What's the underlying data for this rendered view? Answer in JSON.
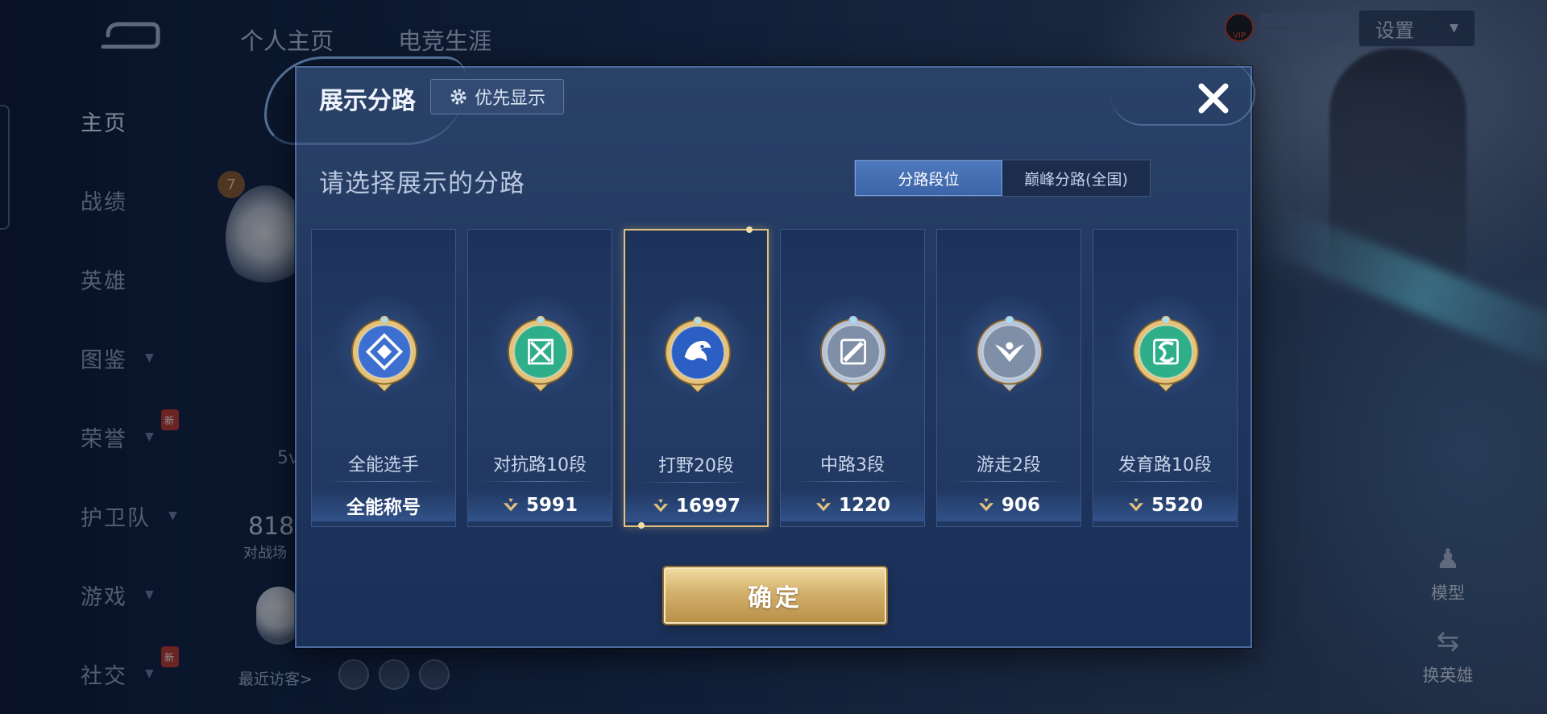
{
  "sidebar": {
    "items": [
      {
        "label": "主页",
        "active": true,
        "has_chevron": false,
        "badge": ""
      },
      {
        "label": "战绩",
        "active": false,
        "has_chevron": false,
        "badge": ""
      },
      {
        "label": "英雄",
        "active": false,
        "has_chevron": false,
        "badge": ""
      },
      {
        "label": "图鉴",
        "active": false,
        "has_chevron": true,
        "badge": ""
      },
      {
        "label": "荣誉",
        "active": false,
        "has_chevron": true,
        "badge": "新"
      },
      {
        "label": "护卫队",
        "active": false,
        "has_chevron": true,
        "badge": ""
      },
      {
        "label": "游戏",
        "active": false,
        "has_chevron": true,
        "badge": ""
      },
      {
        "label": "社交",
        "active": false,
        "has_chevron": true,
        "badge": "新"
      }
    ]
  },
  "header": {
    "tabs": [
      "个人主页",
      "电竞生涯"
    ],
    "settings_label": "设置",
    "vip_label": "VIP"
  },
  "profile_bg": {
    "level": "7",
    "games_count": "818",
    "games_label": "对战场",
    "recent_visitors_label": "最近访客>",
    "mode_text": "5v"
  },
  "right_actions": [
    {
      "label": "模型",
      "icon": "figure-icon"
    },
    {
      "label": "换英雄",
      "icon": "hero-swap-icon"
    }
  ],
  "modal": {
    "title": "展示分路",
    "priority_label": "优先显示",
    "subtitle": "请选择展示的分路",
    "tabs": [
      {
        "label": "分路段位",
        "active": true
      },
      {
        "label": "巅峰分路(全国)",
        "active": false
      }
    ],
    "lanes": [
      {
        "name": "全能选手",
        "value": "全能称号",
        "has_points_icon": false,
        "selected": false,
        "emblem": "all-round-emblem-icon",
        "color": "#3c6fd0"
      },
      {
        "name": "对抗路10段",
        "value": "5991",
        "has_points_icon": true,
        "selected": false,
        "emblem": "clash-lane-emblem-icon",
        "color": "#2fae8a"
      },
      {
        "name": "打野20段",
        "value": "16997",
        "has_points_icon": true,
        "selected": true,
        "emblem": "jungle-emblem-icon",
        "color": "#2c5fc4"
      },
      {
        "name": "中路3段",
        "value": "1220",
        "has_points_icon": true,
        "selected": false,
        "emblem": "mid-lane-emblem-icon",
        "color": "#7f8fa8"
      },
      {
        "name": "游走2段",
        "value": "906",
        "has_points_icon": true,
        "selected": false,
        "emblem": "roam-emblem-icon",
        "color": "#7f8fa8"
      },
      {
        "name": "发育路10段",
        "value": "5520",
        "has_points_icon": true,
        "selected": false,
        "emblem": "farm-lane-emblem-icon",
        "color": "#2fae8a"
      }
    ],
    "confirm_label": "确定"
  },
  "colors": {
    "gold": "#e2c27d",
    "modal_bg": "#213760",
    "tab_active": "#4f79bd"
  }
}
